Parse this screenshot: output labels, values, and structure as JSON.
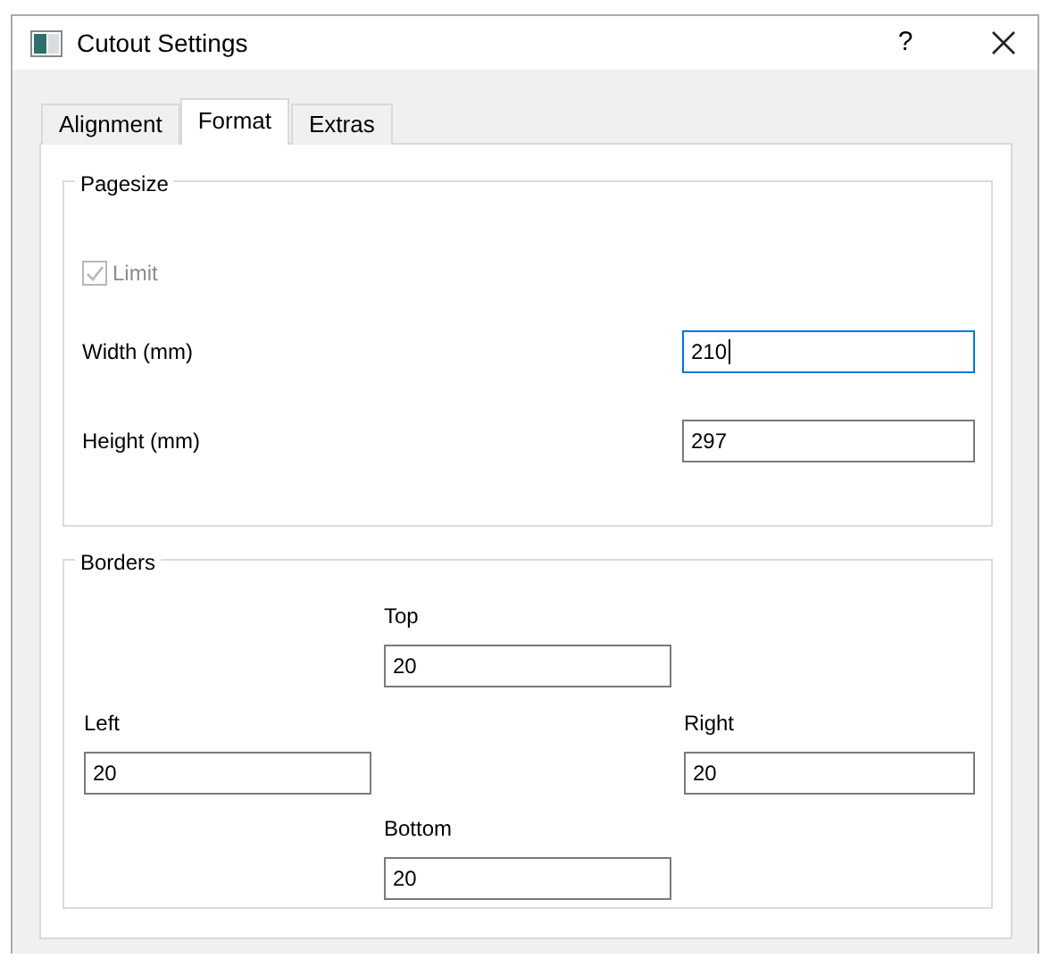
{
  "window": {
    "title": "Cutout Settings",
    "help": "?"
  },
  "tabs": [
    {
      "label": "Alignment",
      "selected": false
    },
    {
      "label": "Format",
      "selected": true
    },
    {
      "label": "Extras",
      "selected": false
    }
  ],
  "pagesize": {
    "title": "Pagesize",
    "limit": {
      "label": "Limit",
      "checked": true,
      "disabled": true
    },
    "fields": [
      {
        "label": "Width (mm)",
        "value": "210",
        "focused": true
      },
      {
        "label": "Height (mm)",
        "value": "297",
        "focused": false
      }
    ]
  },
  "borders": {
    "title": "Borders",
    "fields": [
      {
        "label": "Top",
        "value": "20"
      },
      {
        "label": "Left",
        "value": "20"
      },
      {
        "label": "Right",
        "value": "20"
      },
      {
        "label": "Bottom",
        "value": "20"
      }
    ]
  }
}
